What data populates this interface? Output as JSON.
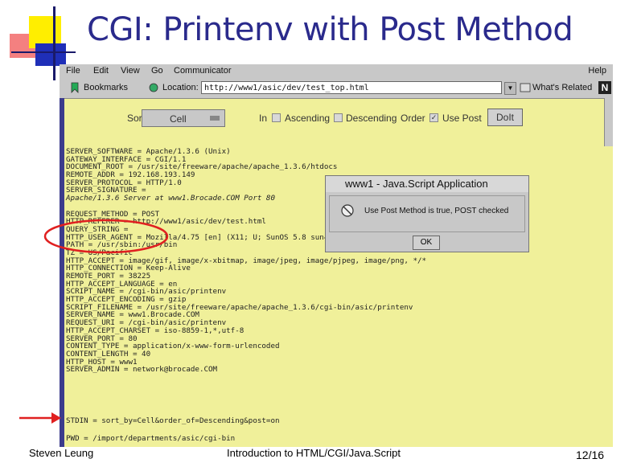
{
  "slide": {
    "title": "CGI: Printenv with Post Method",
    "footer_left": "Steven Leung",
    "footer_center": "Introduction to HTML/CGI/Java.Script",
    "footer_right": "12/16"
  },
  "browser": {
    "menu": [
      "File",
      "Edit",
      "View",
      "Go",
      "Communicator"
    ],
    "menu_help": "Help",
    "toolbar": {
      "bookmarks": "Bookmarks",
      "location_label": "Location:",
      "url": "http://www1/asic/dev/test_top.html",
      "whats_related": "What's Related"
    }
  },
  "form": {
    "sort_by_label": "Sort By",
    "sort_value": "Cell",
    "in_label": "In",
    "ascending_label": "Ascending",
    "descending_label": "Descending",
    "order_label": "Order",
    "use_post_label": "Use Post",
    "use_post_checked": true,
    "doit_label": "DoIt"
  },
  "env": [
    "SERVER_SOFTWARE = Apache/1.3.6 (Unix)",
    "GATEWAY_INTERFACE = CGI/1.1",
    "DOCUMENT_ROOT = /usr/site/freeware/apache/apache_1.3.6/htdocs",
    "REMOTE_ADDR = 192.168.193.149",
    "SERVER_PROTOCOL = HTTP/1.0",
    "SERVER_SIGNATURE =",
    "Apache/1.3.6 Server at www1.Brocade.COM Port 80",
    "",
    "REQUEST_METHOD = POST",
    "HTTP_REFERER = http://www1/asic/dev/test.html",
    "QUERY_STRING =",
    "HTTP_USER_AGENT = Mozilla/4.75 [en] (X11; U; SunOS 5.8 sun4u)",
    "PATH = /usr/sbin:/usr/bin",
    "TZ = US/Pacific",
    "HTTP_ACCEPT = image/gif, image/x-xbitmap, image/jpeg, image/pjpeg, image/png, */*",
    "HTTP_CONNECTION = Keep-Alive",
    "REMOTE_PORT = 38225",
    "HTTP_ACCEPT_LANGUAGE = en",
    "SCRIPT_NAME = /cgi-bin/asic/printenv",
    "HTTP_ACCEPT_ENCODING = gzip",
    "SCRIPT_FILENAME = /usr/site/freeware/apache/apache_1.3.6/cgi-bin/asic/printenv",
    "SERVER_NAME = www1.Brocade.COM",
    "REQUEST_URI = /cgi-bin/asic/printenv",
    "HTTP_ACCEPT_CHARSET = iso-8859-1,*,utf-8",
    "SERVER_PORT = 80",
    "CONTENT_TYPE = application/x-www-form-urlencoded",
    "CONTENT_LENGTH = 40",
    "HTTP_HOST = www1",
    "SERVER_ADMIN = network@brocade.COM"
  ],
  "stdin": "STDIN = sort_by=Cell&order_of=Descending&post=on",
  "pwd": "PWD = /import/departments/asic/cgi-bin",
  "dialog": {
    "title": "www1 - Java.Script Application",
    "message": "Use Post Method is true, POST checked",
    "ok": "OK"
  },
  "colors": {
    "title": "#2a2a8c",
    "page_bg": "#f0f09a",
    "annotation": "#e02020"
  }
}
